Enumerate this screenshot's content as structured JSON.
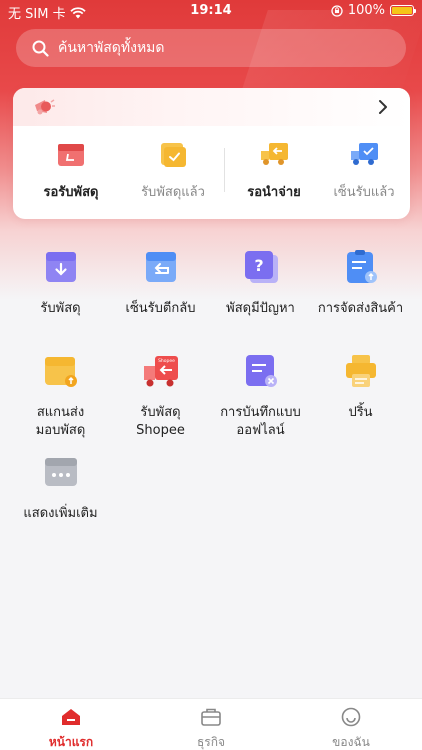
{
  "status_bar": {
    "carrier": "无 SIM 卡",
    "time": "19:14",
    "battery": "100%"
  },
  "search": {
    "placeholder": "ค้นหาพัสดุทั้งหมด"
  },
  "summary_card": {
    "stats": [
      {
        "label": "รอรับพัสดุ",
        "icon": "package-box-icon"
      },
      {
        "label": "รับพัสดุแล้ว",
        "icon": "package-check-icon"
      },
      {
        "label": "รอนำจ่าย",
        "icon": "delivery-truck-icon"
      },
      {
        "label": "เซ็นรับแล้ว",
        "icon": "signed-truck-icon"
      }
    ]
  },
  "grid": {
    "items": [
      {
        "label": "รับพัสดุ",
        "icon": "receive-box-icon"
      },
      {
        "label": "เซ็นรับตีกลับ",
        "icon": "return-box-icon"
      },
      {
        "label": "พัสดุมีปัญหา",
        "icon": "question-icon"
      },
      {
        "label": "การจัดส่งสินค้า",
        "icon": "shipping-clipboard-icon"
      },
      {
        "label": "สแกนส่ง\nมอบพัสดุ",
        "line1": "สแกนส่ง",
        "line2": "มอบพัสดุ",
        "icon": "scan-handover-icon"
      },
      {
        "label": "รับพัสดุ\nShopee",
        "line1": "รับพัสดุ",
        "line2": "Shopee",
        "icon": "shopee-truck-icon"
      },
      {
        "label": "การบันทึกแบบ\nออฟไลน์",
        "line1": "การบันทึกแบบ",
        "line2": "ออฟไลน์",
        "icon": "offline-note-icon"
      },
      {
        "label": "ปริ้น",
        "icon": "printer-icon"
      },
      {
        "label": "แสดงเพิ่มเติม",
        "icon": "more-icon"
      }
    ]
  },
  "tabbar": {
    "tabs": [
      {
        "label": "หน้าแรก",
        "icon": "home-icon",
        "active": true
      },
      {
        "label": "ธุรกิจ",
        "icon": "briefcase-icon",
        "active": false
      },
      {
        "label": "ของฉัน",
        "icon": "smiley-icon",
        "active": false
      }
    ]
  },
  "colors": {
    "brand_red": "#e02c2c",
    "header_red": "#e03a3a",
    "icon_purple": "#7b6ef0",
    "icon_blue": "#4f8ef5",
    "icon_yellow": "#f5b731"
  }
}
